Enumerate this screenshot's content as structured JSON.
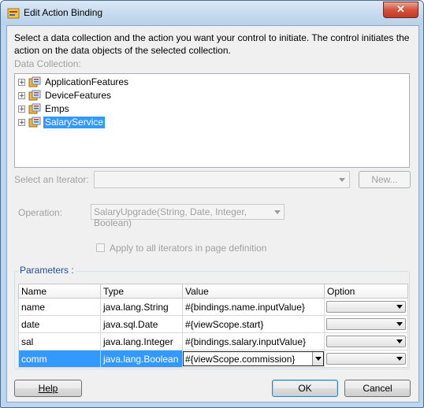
{
  "window": {
    "title": "Edit Action Binding",
    "close_glyph": "✕"
  },
  "description": "Select a data collection and the action you want your control to initiate. The control initiates the action on the data objects of the selected collection.",
  "data_collection": {
    "label": "Data Collection:",
    "items": [
      {
        "label": "ApplicationFeatures",
        "selected": false
      },
      {
        "label": "DeviceFeatures",
        "selected": false
      },
      {
        "label": "Emps",
        "selected": false
      },
      {
        "label": "SalaryService",
        "selected": true
      }
    ],
    "expander_glyph": "+"
  },
  "iterator": {
    "label": "Select an Iterator:",
    "value": "",
    "new_button": "New..."
  },
  "operation": {
    "label": "Operation:",
    "value": "SalaryUpgrade(String, Date, Integer, Boolean)"
  },
  "apply_all": {
    "label": "Apply to all iterators in page definition",
    "checked": false
  },
  "parameters": {
    "label": "Parameters :",
    "columns": [
      "Name",
      "Type",
      "Value",
      "Option"
    ],
    "rows": [
      {
        "name": "name",
        "type": "java.lang.String",
        "value": "#{bindings.name.inputValue}",
        "option": ""
      },
      {
        "name": "date",
        "type": "java.sql.Date",
        "value": "#{viewScope.start}",
        "option": ""
      },
      {
        "name": "sal",
        "type": "java.lang.Integer",
        "value": "#{bindings.salary.inputValue}",
        "option": ""
      },
      {
        "name": "comm",
        "type": "java.lang.Boolean",
        "value": "#{viewScope.commission}",
        "option": ""
      }
    ]
  },
  "buttons": {
    "help": "Help",
    "ok": "OK",
    "cancel": "Cancel"
  },
  "colors": {
    "selection": "#3399ff",
    "titlebar": "#c4d9ee",
    "close": "#c23a24"
  }
}
